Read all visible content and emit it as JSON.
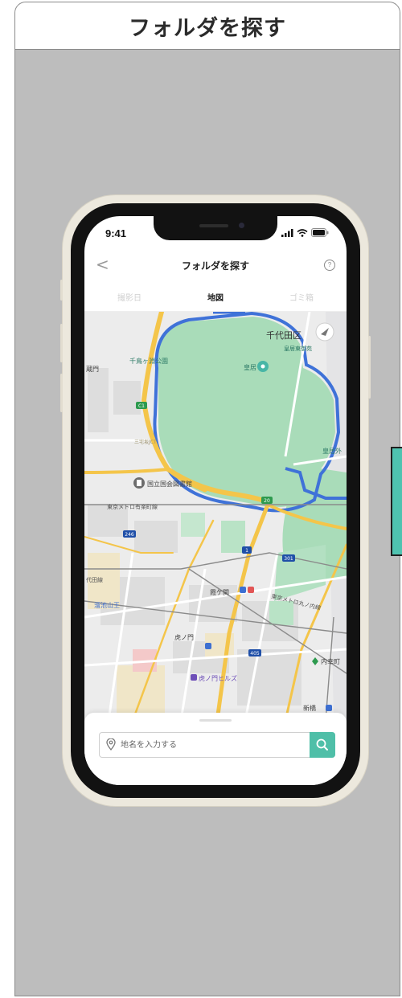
{
  "slide": {
    "title": "フォルダを探す"
  },
  "status": {
    "time": "9:41"
  },
  "nav": {
    "back": "<",
    "title": "フォルダを探す",
    "help": "?"
  },
  "tabs": [
    {
      "label": "撮影日",
      "active": false
    },
    {
      "label": "地図",
      "active": true
    },
    {
      "label": "ゴミ箱",
      "active": false
    }
  ],
  "map": {
    "labels": {
      "district": "千代田区",
      "kokyo_higashi": "皇居東御苑",
      "kokyo": "皇居",
      "chidorigafuchi": "千鳥ヶ淵公園",
      "kuramon": "蔵門",
      "kokkai_toshokan": "国立国会図書館",
      "yurakucho_line": "東京メトロ有楽町線",
      "kasumigaseki": "霞ケ関",
      "marunouchi_line": "東京メトロ丸ノ内線",
      "chiyoda_line": "代田線",
      "tameike_sanno": "溜池山王",
      "toranomon": "虎ノ門",
      "uchisaiwaicho": "内幸町",
      "toranomon_hills": "虎ノ門ヒルズ",
      "shimbashi": "新橋",
      "kokyo_gaien": "皇居外",
      "route_c1": "C1",
      "route_20": "20",
      "route_1": "1",
      "route_301": "301",
      "route_246": "246",
      "route_405": "405",
      "sakuradamon": "三宅坂JCT"
    }
  },
  "search": {
    "placeholder": "地名を入力する"
  },
  "colors": {
    "accent": "#4fbfa8",
    "park": "#a9dcb9",
    "water": "#3f72d8",
    "road": "#f4c54a"
  }
}
